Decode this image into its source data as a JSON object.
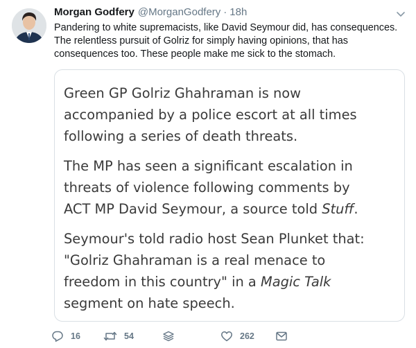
{
  "tweet": {
    "author_name": "Morgan Godfery",
    "author_handle": "@MorganGodfery",
    "separator": "·",
    "timestamp": "18h",
    "text_lines": [
      "Pandering to white supremacists, like David Seymour did, has consequences.",
      "The relentless pursuit of Golriz for simply having opinions, that has",
      "consequences too. These people make me sick to the stomach."
    ]
  },
  "quote": {
    "p1": [
      "Green GP Golriz Ghahraman is now",
      "accompanied by a police escort at all times",
      "following a series of death threats."
    ],
    "p2": {
      "line1": "The MP has seen a significant escalation in",
      "line2": "threats of violence following comments by",
      "line3_prefix": "ACT MP David Seymour, a source told ",
      "line3_italic": "Stuff",
      "line3_suffix": "."
    },
    "p3": {
      "line1": "Seymour's told radio host Sean Plunket that:",
      "line2": "\"Golriz Ghahraman is a real menace to",
      "line3_prefix": "freedom in this country\" in a ",
      "line3_italic": "Magic Talk",
      "line4": "segment on hate speech."
    }
  },
  "actions": {
    "replies": "16",
    "retweets": "54",
    "likes": "262"
  },
  "icons": {
    "reply": "reply-icon",
    "retweet": "retweet-icon",
    "stack": "stack-icon",
    "like": "heart-icon",
    "message": "envelope-icon",
    "caret": "chevron-down-icon"
  },
  "colors": {
    "text": "#14171a",
    "muted": "#657786",
    "card_border": "#d9dfe4",
    "quote_text": "#3a3a3a"
  }
}
